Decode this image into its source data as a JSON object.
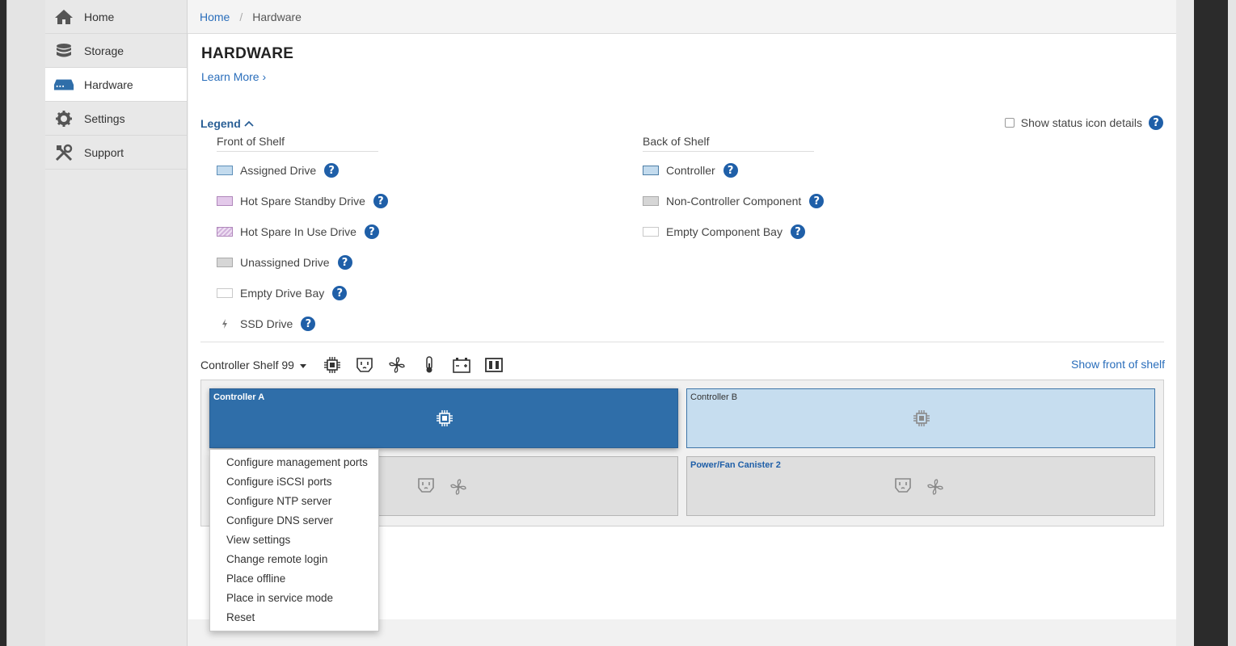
{
  "sidebar": {
    "items": [
      {
        "label": "Home",
        "icon": "home-icon"
      },
      {
        "label": "Storage",
        "icon": "database-icon"
      },
      {
        "label": "Hardware",
        "icon": "hardware-icon",
        "active": true
      },
      {
        "label": "Settings",
        "icon": "gear-icon"
      },
      {
        "label": "Support",
        "icon": "tools-icon"
      }
    ]
  },
  "breadcrumb": {
    "home": "Home",
    "separator": "/",
    "current": "Hardware"
  },
  "page": {
    "title": "HARDWARE",
    "learn_more": "Learn More ›"
  },
  "legend": {
    "toggle_label": "Legend",
    "status_details_label": "Show status icon details",
    "front": {
      "header": "Front of Shelf",
      "items": [
        "Assigned Drive",
        "Hot Spare Standby Drive",
        "Hot Spare In Use Drive",
        "Unassigned Drive",
        "Empty Drive Bay",
        "SSD Drive"
      ]
    },
    "back": {
      "header": "Back of Shelf",
      "items": [
        "Controller",
        "Non-Controller Component",
        "Empty Component Bay"
      ]
    },
    "help_glyph": "?"
  },
  "shelf": {
    "selector_label": "Controller Shelf 99",
    "show_front_label": "Show front of shelf",
    "icons": [
      "chip-icon",
      "power-outlet-icon",
      "fan-icon",
      "thermometer-icon",
      "battery-icon",
      "drive-bay-icon"
    ],
    "components": {
      "controller_a": "Controller A",
      "controller_b": "Controller B",
      "power_fan_2": "Power/Fan Canister 2"
    }
  },
  "context_menu": {
    "items": [
      "Configure management ports",
      "Configure iSCSI ports",
      "Configure NTP server",
      "Configure DNS server",
      "View settings",
      "Change remote login",
      "Place offline",
      "Place in service mode",
      "Reset"
    ]
  },
  "colors": {
    "accent": "#2a6ebb",
    "controller_selected": "#2f6ea9",
    "controller": "#c6ddef",
    "help_icon": "#1f5fa8"
  }
}
